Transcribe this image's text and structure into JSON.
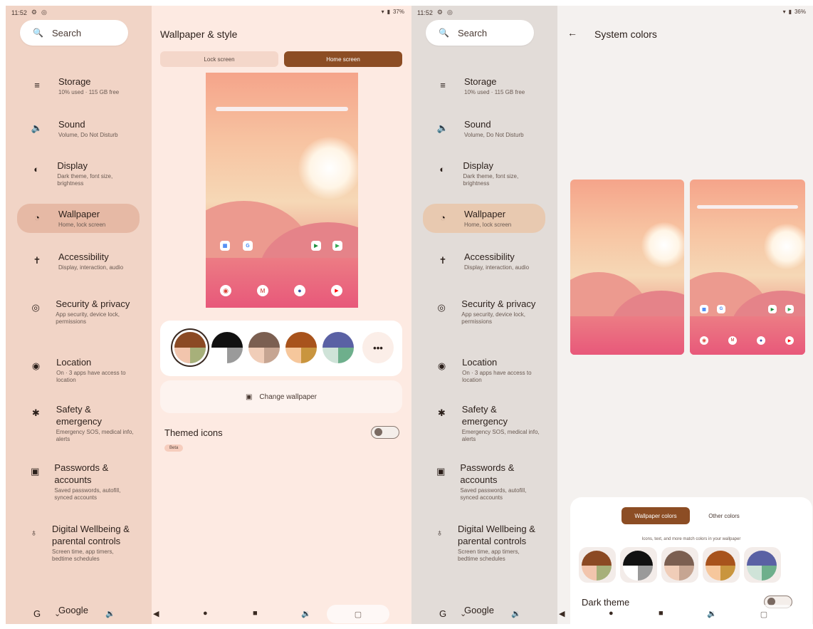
{
  "left": {
    "status": {
      "time": "11:52",
      "battery": "37%"
    },
    "search_label": "Search",
    "nav": [
      {
        "title": "Storage",
        "sub": "10% used · 115 GB free",
        "icon": "storage-icon",
        "glyph": "≡"
      },
      {
        "title": "Sound",
        "sub": "Volume, Do Not Disturb",
        "icon": "sound-icon",
        "glyph": "🔈"
      },
      {
        "title": "Display",
        "sub": "Dark theme, font size, brightness",
        "icon": "display-icon",
        "glyph": "◐"
      },
      {
        "title": "Wallpaper",
        "sub": "Home, lock screen",
        "icon": "palette-icon",
        "glyph": "◔"
      },
      {
        "title": "Accessibility",
        "sub": "Display, interaction, audio",
        "icon": "accessibility-icon",
        "glyph": "✝"
      },
      {
        "title": "Security & privacy",
        "sub": "App security, device lock, permissions",
        "icon": "shield-icon",
        "glyph": "◎"
      },
      {
        "title": "Location",
        "sub": "On · 3 apps have access to location",
        "icon": "location-icon",
        "glyph": "◉"
      },
      {
        "title": "Safety & emergency",
        "sub": "Emergency SOS, medical info, alerts",
        "icon": "asterisk-icon",
        "glyph": "✱"
      },
      {
        "title": "Passwords & accounts",
        "sub": "Saved passwords, autofill, synced accounts",
        "icon": "account-icon",
        "glyph": "▣"
      },
      {
        "title": "Digital Wellbeing & parental controls",
        "sub": "Screen time, app timers, bedtime schedules",
        "icon": "wellbeing-icon",
        "glyph": "♁"
      },
      {
        "title": "Google",
        "sub": "",
        "icon": "google-icon",
        "glyph": "G"
      }
    ],
    "page_title": "Wallpaper & style",
    "tabs": {
      "lock": "Lock screen",
      "home": "Home screen"
    },
    "more_label": "•••",
    "change_wallpaper": "Change wallpaper",
    "themed_icons": "Themed icons",
    "beta": "Beta"
  },
  "right": {
    "status": {
      "time": "11:52",
      "battery": "36%"
    },
    "search_label": "Search",
    "page_title": "System colors",
    "tabs": {
      "wallpaper": "Wallpaper colors",
      "other": "Other colors"
    },
    "sheet_desc": "Icons, text, and more match colors in your wallpaper",
    "dark_theme": "Dark theme"
  },
  "swatches": [
    {
      "top": "#8b4a24",
      "bl": "#f2c5ad",
      "br": "#a7b07a"
    },
    {
      "top": "#111111",
      "bl": "#ffffff",
      "br": "#9a9a9a"
    },
    {
      "top": "#7b5f51",
      "bl": "#f0cdb8",
      "br": "#c6a592"
    },
    {
      "top": "#a8531c",
      "bl": "#f6c79c",
      "br": "#c9953e"
    },
    {
      "top": "#5a61a4",
      "bl": "#cfe3d8",
      "br": "#6eaf8c"
    }
  ],
  "navbar": {
    "back": "◀",
    "home": "●",
    "recents": "■",
    "volume": "🔉",
    "down": "⌄",
    "rotate": "▢"
  },
  "colors": {
    "accent": "#8c4d24"
  }
}
